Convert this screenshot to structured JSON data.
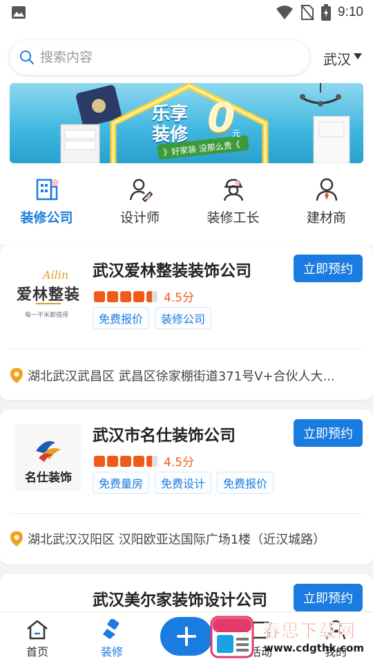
{
  "status_bar": {
    "time": "9:10"
  },
  "search": {
    "placeholder": "搜索内容"
  },
  "city": {
    "label": "武汉"
  },
  "banner": {
    "title_line1": "乐享",
    "title_line2": "装修",
    "zero": "0",
    "unit": "元",
    "slogan": "》好家装 没那么贵《"
  },
  "categories": [
    {
      "label": "装修公司",
      "icon": "building-icon",
      "active": true
    },
    {
      "label": "设计师",
      "icon": "designer-icon",
      "active": false
    },
    {
      "label": "装修工长",
      "icon": "foreman-icon",
      "active": false
    },
    {
      "label": "建材商",
      "icon": "merchant-icon",
      "active": false
    }
  ],
  "companies": [
    {
      "name": "武汉爱林整装装饰公司",
      "logo_text": "爱林整装",
      "logo_script": "Ailin",
      "logo_sub": "每一平米都值得",
      "score": "4.5分",
      "rating": 4.5,
      "tags": [
        "免费报价",
        "装修公司"
      ],
      "address": "湖北武汉武昌区 武昌区徐家棚街道371号V+合伙人大...",
      "book_label": "立即预约"
    },
    {
      "name": "武汉市名仕装饰公司",
      "logo_text": "名仕装饰",
      "score": "4.5分",
      "rating": 4.5,
      "tags": [
        "免费量房",
        "免费设计",
        "免费报价"
      ],
      "address": "湖北武汉汉阳区 汉阳欧亚达国际广场1楼（近汉城路）",
      "book_label": "立即预约"
    },
    {
      "name": "武汉美尔家装饰设计公司",
      "book_label": "立即预约"
    }
  ],
  "bottom_nav": [
    {
      "label": "首页",
      "icon": "home-icon",
      "active": false
    },
    {
      "label": "装修",
      "icon": "brush-icon",
      "active": true
    },
    {
      "label": "",
      "icon": "plus-icon",
      "active": false
    },
    {
      "label": "活动",
      "icon": "activity-icon",
      "active": false
    },
    {
      "label": "我的",
      "icon": "profile-icon",
      "active": false
    }
  ],
  "watermark": {
    "title": "春思下载网",
    "url": "www.cdgthk.com"
  },
  "colors": {
    "accent": "#1a7be0",
    "star": "#f25a1b",
    "pin": "#f5a21b"
  }
}
